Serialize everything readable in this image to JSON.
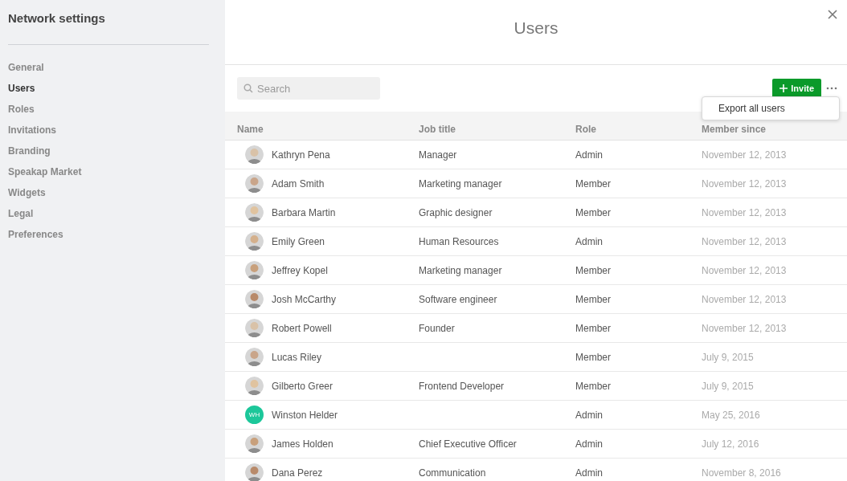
{
  "sidebar": {
    "title": "Network settings",
    "items": [
      {
        "label": "General",
        "selected": false
      },
      {
        "label": "Users",
        "selected": true
      },
      {
        "label": "Roles",
        "selected": false
      },
      {
        "label": "Invitations",
        "selected": false
      },
      {
        "label": "Branding",
        "selected": false
      },
      {
        "label": "Speakap Market",
        "selected": false
      },
      {
        "label": "Widgets",
        "selected": false
      },
      {
        "label": "Legal",
        "selected": false
      },
      {
        "label": "Preferences",
        "selected": false
      }
    ]
  },
  "page": {
    "title": "Users"
  },
  "search": {
    "placeholder": "Search"
  },
  "invite_button": {
    "label": "Invite"
  },
  "menu": {
    "items": [
      "Export all users"
    ]
  },
  "table": {
    "columns": [
      "Name",
      "Job title",
      "Role",
      "Member since"
    ],
    "rows": [
      {
        "avatar": {
          "kind": "photo"
        },
        "name": "Kathryn Pena",
        "job_title": "Manager",
        "role": "Admin",
        "member_since": "November 12, 2013"
      },
      {
        "avatar": {
          "kind": "photo"
        },
        "name": "Adam Smith",
        "job_title": "Marketing manager",
        "role": "Member",
        "member_since": "November 12, 2013"
      },
      {
        "avatar": {
          "kind": "photo"
        },
        "name": "Barbara Martin",
        "job_title": "Graphic designer",
        "role": "Member",
        "member_since": "November 12, 2013"
      },
      {
        "avatar": {
          "kind": "photo"
        },
        "name": "Emily Green",
        "job_title": "Human Resources",
        "role": "Admin",
        "member_since": "November 12, 2013"
      },
      {
        "avatar": {
          "kind": "photo"
        },
        "name": "Jeffrey Kopel",
        "job_title": "Marketing manager",
        "role": "Member",
        "member_since": "November 12, 2013"
      },
      {
        "avatar": {
          "kind": "photo"
        },
        "name": "Josh McCarthy",
        "job_title": "Software engineer",
        "role": "Member",
        "member_since": "November 12, 2013"
      },
      {
        "avatar": {
          "kind": "photo"
        },
        "name": "Robert Powell",
        "job_title": "Founder",
        "role": "Member",
        "member_since": "November 12, 2013"
      },
      {
        "avatar": {
          "kind": "photo"
        },
        "name": "Lucas Riley",
        "role": "Member",
        "member_since": "July 9, 2015"
      },
      {
        "avatar": {
          "kind": "photo"
        },
        "name": "Gilberto Greer",
        "job_title": "Frontend Developer",
        "role": "Member",
        "member_since": "July 9, 2015"
      },
      {
        "avatar": {
          "kind": "initials",
          "initials": "WH",
          "color": "#1cc79a"
        },
        "name": "Winston Helder",
        "role": "Admin",
        "member_since": "May 25, 2016"
      },
      {
        "avatar": {
          "kind": "photo"
        },
        "name": "James Holden",
        "job_title": "Chief Executive Officer",
        "role": "Admin",
        "member_since": "July 12, 2016"
      },
      {
        "avatar": {
          "kind": "photo"
        },
        "name": "Dana Perez",
        "job_title": "Communication",
        "role": "Admin",
        "member_since": "November 8, 2016"
      }
    ]
  }
}
